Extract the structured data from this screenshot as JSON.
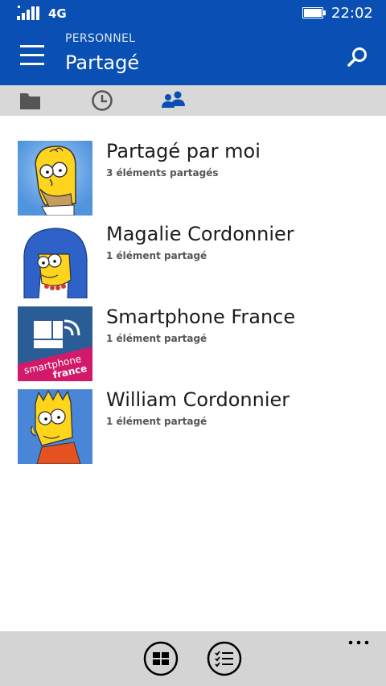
{
  "status_bar": {
    "network": "4G",
    "time": "22:02",
    "signal_icon": "signal-icon",
    "battery_icon": "battery-icon"
  },
  "header": {
    "breadcrumb": "PERSONNEL",
    "title": "Partagé",
    "menu_icon": "hamburger-icon",
    "search_icon": "search-icon"
  },
  "tabs": [
    {
      "icon": "folder-icon",
      "selected": false
    },
    {
      "icon": "recent-clock-icon",
      "selected": false
    },
    {
      "icon": "shared-people-icon",
      "selected": true
    }
  ],
  "items": [
    {
      "title": "Partagé par moi",
      "subtitle": "3 éléments partagés",
      "avatar": "homer-avatar"
    },
    {
      "title": "Magalie Cordonnier",
      "subtitle": "1 élément partagé",
      "avatar": "marge-avatar"
    },
    {
      "title": "Smartphone France",
      "subtitle": "1 élément partagé",
      "avatar": "smartphone-france-logo",
      "logo_text": [
        "smartphone",
        "france"
      ]
    },
    {
      "title": "William Cordonnier",
      "subtitle": "1 élément partagé",
      "avatar": "bart-avatar"
    }
  ],
  "app_bar": {
    "buttons": [
      "grid-view-icon",
      "select-list-icon"
    ],
    "more_icon": "more-dots-icon"
  },
  "colors": {
    "accent": "#0a50b4",
    "tabs_bg": "#d8d8d8",
    "appbar_bg": "#d4d4d4",
    "selected_tab": "#0a50b4",
    "unselected_tab": "#555555"
  }
}
